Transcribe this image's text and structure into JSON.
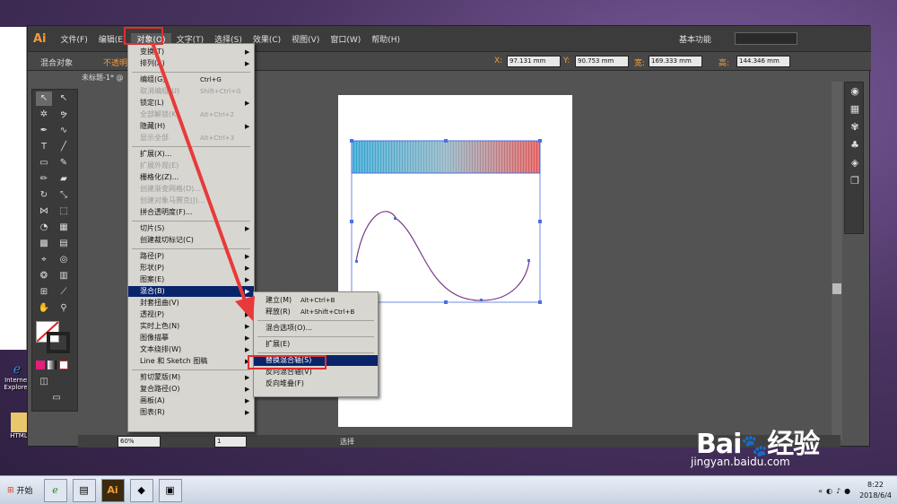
{
  "menubar": {
    "logo": "Ai",
    "items": [
      "文件(F)",
      "编辑(E)",
      "对象(O)",
      "文字(T)",
      "选择(S)",
      "效果(C)",
      "视图(V)",
      "窗口(W)",
      "帮助(H)"
    ],
    "workspace": "基本功能"
  },
  "control": {
    "mode": "混合对象",
    "opacity": "不透明度",
    "x_label": "X:",
    "x": "97.131 mm",
    "y_label": "Y:",
    "y": "90.753 mm",
    "w_label": "宽:",
    "w": "169.333 mm",
    "h_label": "高:",
    "h": "144.346 mm"
  },
  "document": {
    "tab": "未标题-1* @"
  },
  "object_menu": [
    {
      "label": "变换(T)",
      "arrow": true
    },
    {
      "label": "排列(A)",
      "arrow": true
    },
    {
      "sep": true
    },
    {
      "label": "编组(G)",
      "shortcut": "Ctrl+G"
    },
    {
      "label": "取消编组(U)",
      "shortcut": "Shift+Ctrl+G",
      "disabled": true
    },
    {
      "label": "锁定(L)",
      "arrow": true
    },
    {
      "label": "全部解锁(K)",
      "shortcut": "Alt+Ctrl+2",
      "disabled": true
    },
    {
      "label": "隐藏(H)",
      "arrow": true
    },
    {
      "label": "显示全部",
      "shortcut": "Alt+Ctrl+3",
      "disabled": true
    },
    {
      "sep": true
    },
    {
      "label": "扩展(X)..."
    },
    {
      "label": "扩展外观(E)",
      "disabled": true
    },
    {
      "label": "栅格化(Z)..."
    },
    {
      "label": "创建渐变网格(D)...",
      "disabled": true
    },
    {
      "label": "创建对象马赛克(J)...",
      "disabled": true
    },
    {
      "label": "拼合透明度(F)..."
    },
    {
      "sep": true
    },
    {
      "label": "切片(S)",
      "arrow": true
    },
    {
      "label": "创建裁切标记(C)"
    },
    {
      "sep": true
    },
    {
      "label": "路径(P)",
      "arrow": true
    },
    {
      "label": "形状(P)",
      "arrow": true
    },
    {
      "label": "图案(E)",
      "arrow": true
    },
    {
      "label": "混合(B)",
      "arrow": true,
      "highlight": true
    },
    {
      "label": "封套扭曲(V)",
      "arrow": true
    },
    {
      "label": "透视(P)",
      "arrow": true
    },
    {
      "label": "实时上色(N)",
      "arrow": true
    },
    {
      "label": "图像描摹",
      "arrow": true
    },
    {
      "label": "文本绕排(W)",
      "arrow": true
    },
    {
      "label": "Line 和 Sketch 图稿",
      "arrow": true
    },
    {
      "sep": true
    },
    {
      "label": "剪切蒙版(M)",
      "arrow": true
    },
    {
      "label": "复合路径(O)",
      "arrow": true
    },
    {
      "label": "画板(A)",
      "arrow": true
    },
    {
      "label": "图表(R)",
      "arrow": true
    }
  ],
  "blend_menu": [
    {
      "label": "建立(M)",
      "shortcut": "Alt+Ctrl+B"
    },
    {
      "label": "释放(R)",
      "shortcut": "Alt+Shift+Ctrl+B"
    },
    {
      "sep": true
    },
    {
      "label": "混合选项(O)..."
    },
    {
      "sep": true
    },
    {
      "label": "扩展(E)"
    },
    {
      "sep": true
    },
    {
      "label": "替换混合轴(S)",
      "highlight": true
    },
    {
      "label": "反向混合轴(V)"
    },
    {
      "label": "反向堆叠(F)"
    }
  ],
  "status": {
    "zoom": "60%",
    "page": "1",
    "tool": "选择"
  },
  "taskbar": {
    "start": "开始",
    "ai": "Ai",
    "time": "8:22",
    "date": "2018/6/4"
  },
  "desktop": {
    "ie_label": "Internet Explorer",
    "html_label": "HTML"
  },
  "watermark": {
    "logo": "Bai",
    "logo2": "经验",
    "url": "jingyan.baidu.com"
  }
}
